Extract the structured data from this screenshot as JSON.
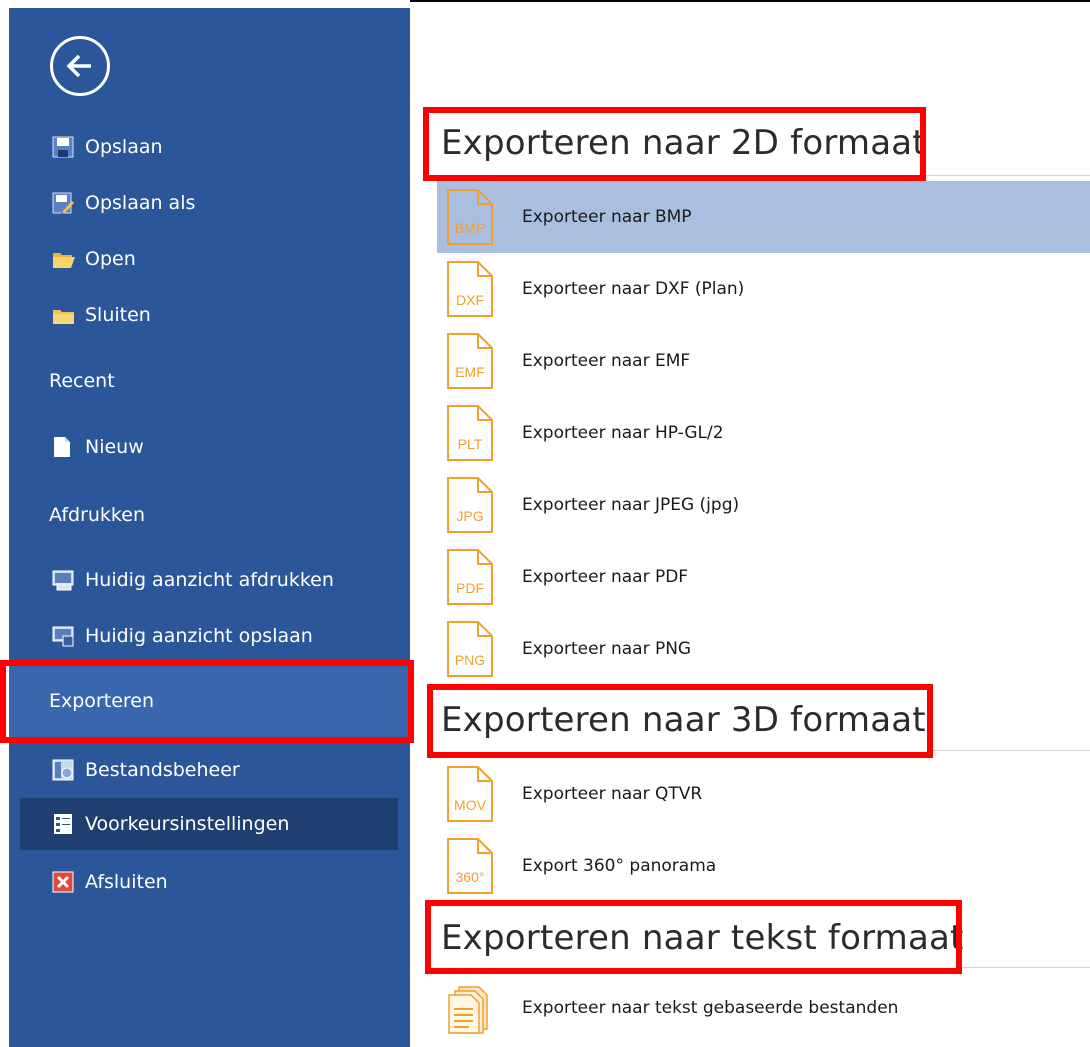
{
  "sidebar": {
    "back_label": "",
    "items": [
      {
        "label": "Opslaan",
        "icon": "save-icon"
      },
      {
        "label": "Opslaan als",
        "icon": "save-as-icon"
      },
      {
        "label": "Open",
        "icon": "open-folder-icon"
      },
      {
        "label": "Sluiten",
        "icon": "close-folder-icon"
      }
    ],
    "recent_label": "Recent",
    "new_label": "Nieuw",
    "print_label": "Afdrukken",
    "print_items": [
      {
        "label": "Huidig aanzicht afdrukken",
        "icon": "print-view-icon"
      },
      {
        "label": "Huidig aanzicht opslaan",
        "icon": "save-view-icon"
      }
    ],
    "export_label": "Exporteren",
    "bottom_items": [
      {
        "label": "Bestandsbeheer",
        "icon": "file-manager-icon"
      },
      {
        "label": "Voorkeursinstellingen",
        "icon": "preferences-icon"
      },
      {
        "label": "Afsluiten",
        "icon": "exit-icon"
      }
    ]
  },
  "main": {
    "sections": [
      {
        "title": "Exporteren naar 2D formaat",
        "items": [
          {
            "label": "Exporteer naar BMP",
            "badge": "BMP"
          },
          {
            "label": "Exporteer naar DXF (Plan)",
            "badge": "DXF"
          },
          {
            "label": "Exporteer naar EMF",
            "badge": "EMF"
          },
          {
            "label": "Exporteer naar HP-GL/2",
            "badge": "PLT"
          },
          {
            "label": "Exporteer naar JPEG (jpg)",
            "badge": "JPG"
          },
          {
            "label": "Exporteer naar PDF",
            "badge": "PDF"
          },
          {
            "label": "Exporteer naar PNG",
            "badge": "PNG"
          }
        ]
      },
      {
        "title": "Exporteren naar 3D formaat",
        "items": [
          {
            "label": "Exporteer naar QTVR",
            "badge": "MOV"
          },
          {
            "label": "Export 360° panorama",
            "badge": "360°"
          }
        ]
      },
      {
        "title": "Exporteren naar tekst formaat",
        "items": [
          {
            "label": "Exporteer naar tekst gebaseerde bestanden",
            "badge": ""
          }
        ]
      }
    ]
  },
  "colors": {
    "sidebar": "#2b579a",
    "sidebar_selected": "#3a66ad",
    "item_selected": "#aabfdf",
    "file_icon": "#f0a030",
    "highlight_box": "#ff0000"
  }
}
